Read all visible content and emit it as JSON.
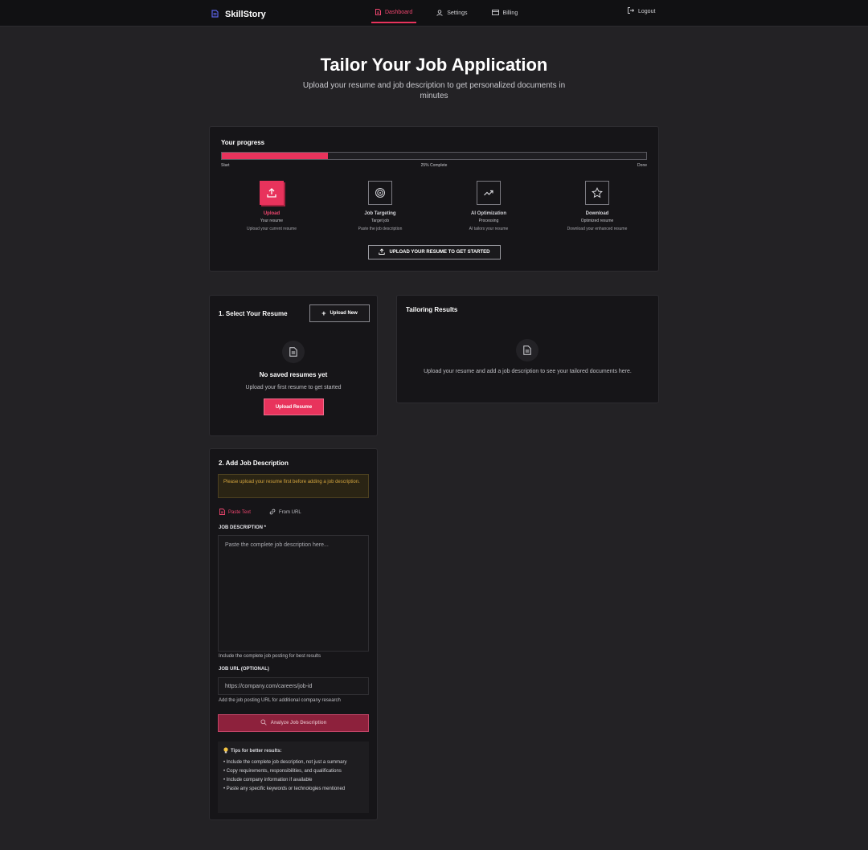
{
  "nav": {
    "brand": "SkillStory",
    "links": [
      {
        "label": "Dashboard",
        "icon": "document-icon",
        "active": true
      },
      {
        "label": "Settings",
        "icon": "user-icon",
        "active": false
      },
      {
        "label": "Billing",
        "icon": "credit-card-icon",
        "active": false
      }
    ],
    "logout": "Logout"
  },
  "hero": {
    "title": "Tailor Your Job Application",
    "subtitle": "Upload your resume and job description to get personalized documents in minutes"
  },
  "progress": {
    "title": "Your progress",
    "value": 0.25,
    "start_label": "Start",
    "center_label": "25% Complete",
    "end_label": "Done",
    "steps": [
      {
        "name": "Upload",
        "sub": "Your resume",
        "desc": "Upload your current resume",
        "icon": "upload-icon",
        "active": true
      },
      {
        "name": "Job Targeting",
        "sub": "Target job",
        "desc": "Paste the job description",
        "icon": "target-icon",
        "active": false
      },
      {
        "name": "AI Optimization",
        "sub": "Processing",
        "desc": "AI tailors your resume",
        "icon": "trend-icon",
        "active": false
      },
      {
        "name": "Download",
        "sub": "Optimized resume",
        "desc": "Download your enhanced resume",
        "icon": "star-icon",
        "active": false
      }
    ],
    "cta": "UPLOAD YOUR RESUME TO GET STARTED"
  },
  "resume": {
    "title": "1. Select Your Resume",
    "upload_new": "Upload New",
    "empty_title": "No saved resumes yet",
    "empty_sub": "Upload your first resume to get started",
    "upload_btn": "Upload Resume"
  },
  "results": {
    "title": "Tailoring Results",
    "empty": "Upload your resume and add a job description to see your tailored documents here."
  },
  "job": {
    "title": "2. Add Job Description",
    "warning": "Please upload your resume first before adding a job description.",
    "tabs": [
      {
        "label": "Paste Text",
        "active": true
      },
      {
        "label": "From URL",
        "active": false
      }
    ],
    "desc_label": "JOB DESCRIPTION *",
    "desc_placeholder": "Paste the complete job description here...",
    "desc_hint": "Include the complete job posting for best results",
    "url_label": "JOB URL (OPTIONAL)",
    "url_placeholder": "https://company.com/careers/job-id",
    "url_hint": "Add the job posting URL for additional company research",
    "analyze": "Analyze Job Description",
    "tips_title": "Tips for better results:",
    "tips": [
      "• Include the complete job description, not just a summary",
      "• Copy requirements, responsibilities, and qualifications",
      "• Include company information if available",
      "• Paste any specific keywords or technologies mentioned"
    ]
  },
  "colors": {
    "accent": "#e8335c",
    "background": "#232225",
    "card": "#161518",
    "warning": "#d4a53e"
  }
}
